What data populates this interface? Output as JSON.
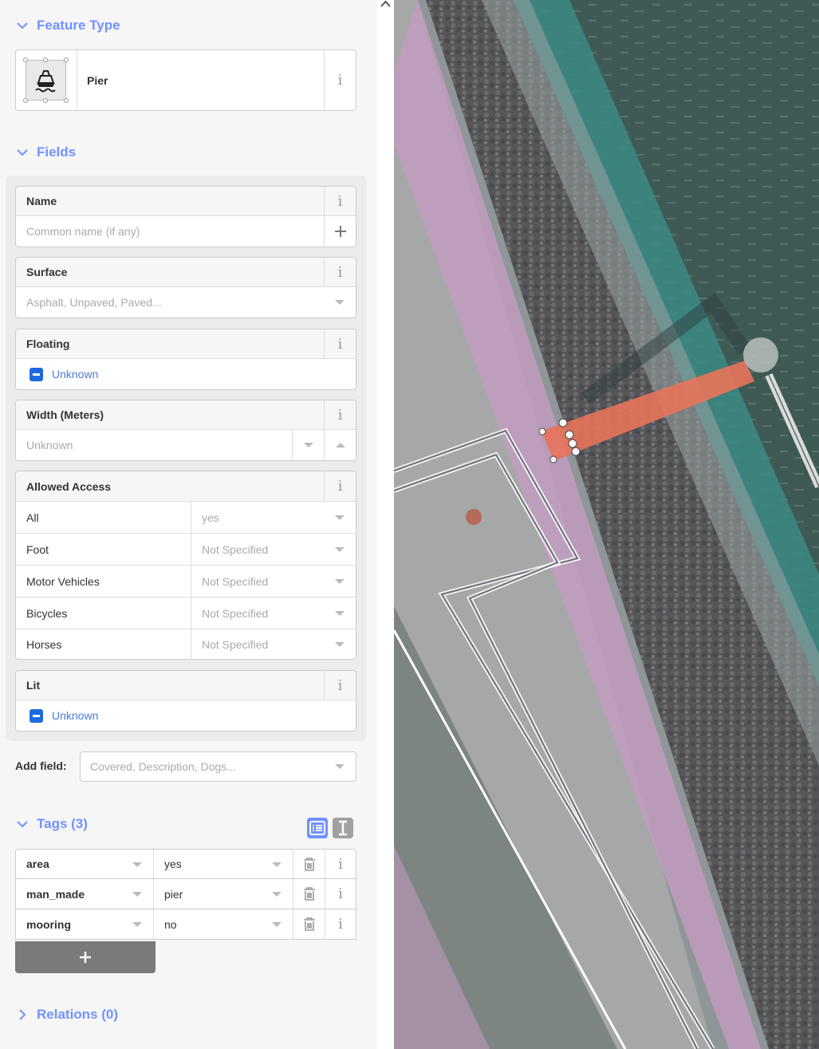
{
  "sections": {
    "feature_type": "Feature Type",
    "fields": "Fields",
    "tags": "Tags (3)",
    "relations": "Relations (0)"
  },
  "preset": {
    "name": "Pier",
    "icon": "pier-icon"
  },
  "fields": {
    "name": {
      "label": "Name",
      "placeholder": "Common name (if any)"
    },
    "surface": {
      "label": "Surface",
      "placeholder": "Asphalt, Unpaved, Paved..."
    },
    "floating": {
      "label": "Floating",
      "value": "Unknown"
    },
    "width": {
      "label": "Width (Meters)",
      "placeholder": "Unknown"
    },
    "access": {
      "label": "Allowed Access",
      "rows": [
        {
          "key": "All",
          "value": "yes"
        },
        {
          "key": "Foot",
          "value": "Not Specified"
        },
        {
          "key": "Motor Vehicles",
          "value": "Not Specified"
        },
        {
          "key": "Bicycles",
          "value": "Not Specified"
        },
        {
          "key": "Horses",
          "value": "Not Specified"
        }
      ]
    },
    "lit": {
      "label": "Lit",
      "value": "Unknown"
    }
  },
  "add_field": {
    "label": "Add field:",
    "placeholder": "Covered, Description, Dogs..."
  },
  "tags": [
    {
      "key": "area",
      "value": "yes"
    },
    {
      "key": "man_made",
      "value": "pier"
    },
    {
      "key": "mooring",
      "value": "no"
    }
  ],
  "colors": {
    "accent": "#7092ff",
    "checkbox": "#1d6ae0",
    "selected_feature": "#e8735a",
    "landuse_pink": "#c79bc4",
    "water": "#3f5a55",
    "rocks": "#5a5a58"
  },
  "icons": {
    "info": "i",
    "plus": "+",
    "add_tag": "+"
  }
}
